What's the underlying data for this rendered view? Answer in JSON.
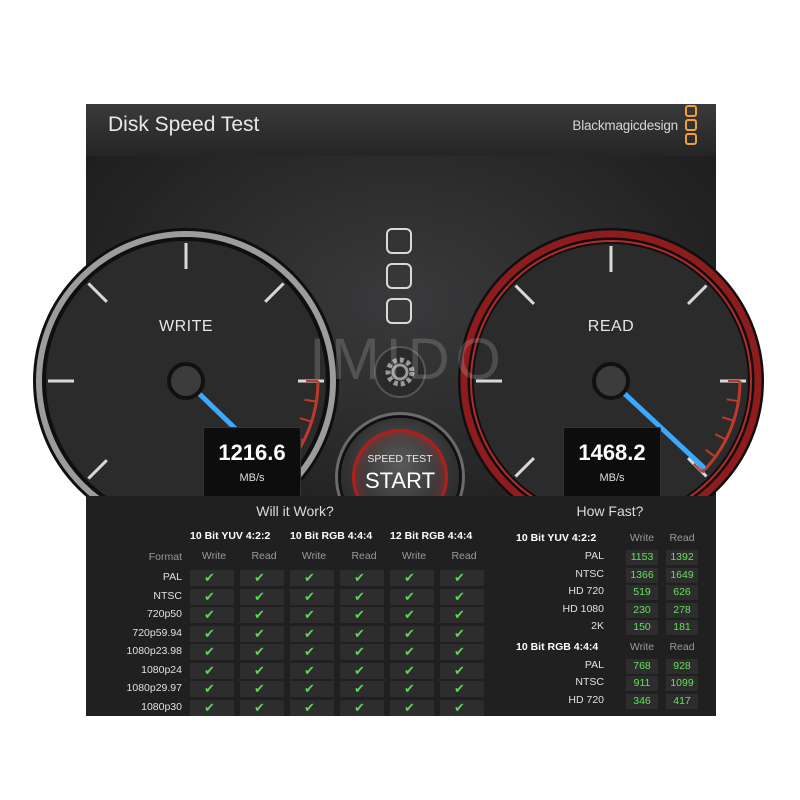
{
  "titlebar": {
    "title": "Disk Speed Test",
    "brand": "Blackmagicdesign"
  },
  "watermark": "IMIDO",
  "write": {
    "label": "WRITE",
    "value": "1216.6",
    "unit": "MB/s"
  },
  "read": {
    "label": "READ",
    "value": "1468.2",
    "unit": "MB/s"
  },
  "start": {
    "small": "SPEED TEST",
    "big": "START"
  },
  "will_it_work": {
    "header": "Will it Work?",
    "format_label": "Format",
    "groups": [
      "10 Bit YUV 4:2:2",
      "10 Bit RGB 4:4:4",
      "12 Bit RGB 4:4:4"
    ],
    "col_write": "Write",
    "col_read": "Read",
    "rows": [
      "PAL",
      "NTSC",
      "720p50",
      "720p59.94",
      "1080p23.98",
      "1080p24",
      "1080p29.97",
      "1080p30"
    ]
  },
  "how_fast": {
    "header": "How Fast?",
    "col_write": "Write",
    "col_read": "Read",
    "sections": [
      {
        "title": "10 Bit YUV 4:2:2",
        "rows": [
          {
            "label": "PAL",
            "write": "1153",
            "read": "1392"
          },
          {
            "label": "NTSC",
            "write": "1366",
            "read": "1649"
          },
          {
            "label": "HD 720",
            "write": "519",
            "read": "626"
          },
          {
            "label": "HD 1080",
            "write": "230",
            "read": "278"
          },
          {
            "label": "2K",
            "write": "150",
            "read": "181"
          }
        ]
      },
      {
        "title": "10 Bit RGB 4:4:4",
        "rows": [
          {
            "label": "PAL",
            "write": "768",
            "read": "928"
          },
          {
            "label": "NTSC",
            "write": "911",
            "read": "1099"
          },
          {
            "label": "HD 720",
            "write": "346",
            "read": "417"
          }
        ]
      }
    ]
  },
  "colors": {
    "check": "#5fd35a",
    "number": "#66e05c",
    "red_ring": "#9e1f1f",
    "needle": "#3aa9ff"
  },
  "icons": [
    "checkmark-icon",
    "gear-icon",
    "blackmagic-logo-icon"
  ]
}
